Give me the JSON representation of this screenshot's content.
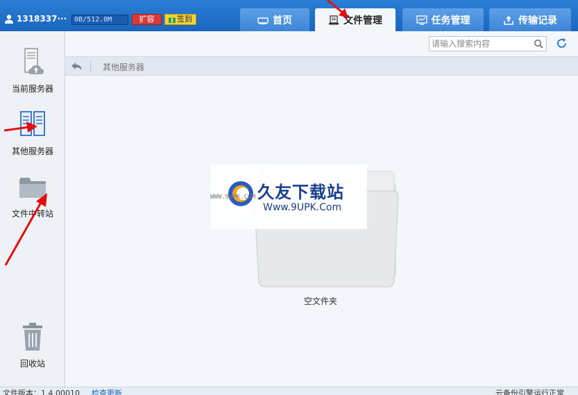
{
  "header": {
    "username": "1318337···",
    "quota": "0B/512.0M",
    "expand_label": "扩容",
    "sign_label": "签到"
  },
  "tabs": [
    {
      "label": "首页",
      "icon": "monitor-icon",
      "active": false
    },
    {
      "label": "文件管理",
      "icon": "file-manage-icon",
      "active": true
    },
    {
      "label": "任务管理",
      "icon": "task-icon",
      "active": false
    },
    {
      "label": "传输记录",
      "icon": "upload-icon",
      "active": false
    }
  ],
  "sidebar": {
    "items": [
      {
        "label": "当前服务器",
        "icon": "cloud-server-icon"
      },
      {
        "label": "其他服务器",
        "icon": "servers-icon"
      },
      {
        "label": "文件中转站",
        "icon": "folder-icon"
      },
      {
        "label": "回收站",
        "icon": "trash-icon"
      }
    ]
  },
  "search": {
    "placeholder": "请输入搜索内容"
  },
  "breadcrumb": {
    "current": "其他服务器"
  },
  "empty_state": {
    "label": "空文件夹"
  },
  "watermark": {
    "title": "久友下载站",
    "url": "Www.9UPK.Com",
    "side": "WWW.9UPK.COM"
  },
  "statusbar": {
    "version": "文件版本：1.4.00010",
    "update_link": "检查更新",
    "status": "云备份引擎运行正常"
  },
  "colors": {
    "header_blue": "#1a66bf",
    "tab_blue": "#3d86d8",
    "expand_red": "#d83a3a",
    "sign_yellow": "#f4d23a",
    "annotation_red": "#e01010"
  }
}
